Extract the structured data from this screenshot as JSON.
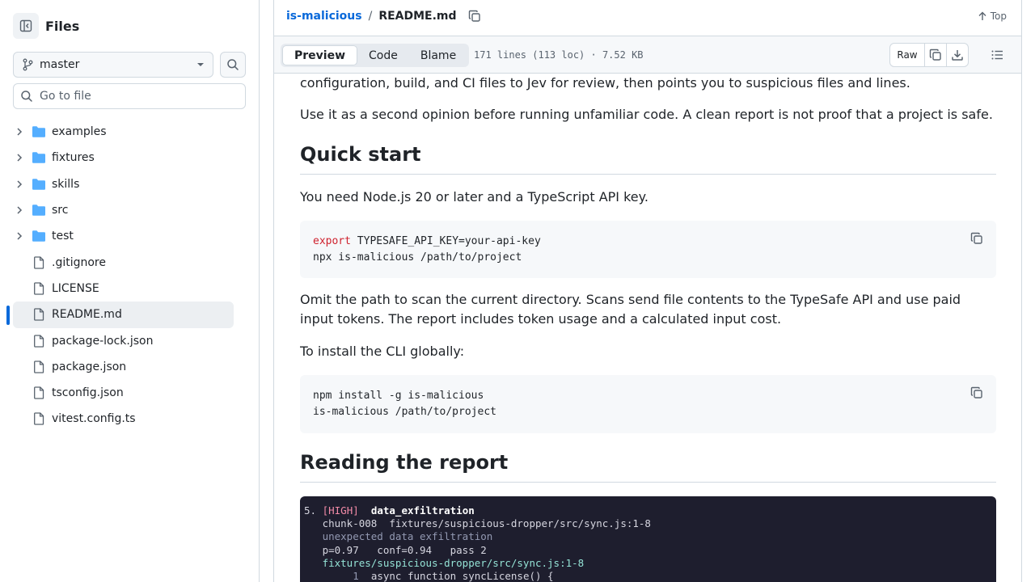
{
  "sidebar": {
    "title": "Files",
    "branch": "master",
    "goto_placeholder": "Go to file",
    "items": [
      {
        "name": "examples",
        "type": "folder"
      },
      {
        "name": "fixtures",
        "type": "folder"
      },
      {
        "name": "skills",
        "type": "folder"
      },
      {
        "name": "src",
        "type": "folder"
      },
      {
        "name": "test",
        "type": "folder"
      },
      {
        "name": ".gitignore",
        "type": "file"
      },
      {
        "name": "LICENSE",
        "type": "file"
      },
      {
        "name": "README.md",
        "type": "file",
        "selected": true
      },
      {
        "name": "package-lock.json",
        "type": "file"
      },
      {
        "name": "package.json",
        "type": "file"
      },
      {
        "name": "tsconfig.json",
        "type": "file"
      },
      {
        "name": "vitest.config.ts",
        "type": "file"
      }
    ]
  },
  "header": {
    "repo": "is-malicious",
    "separator": "/",
    "file": "README.md",
    "top_label": "Top"
  },
  "filebar": {
    "tabs": [
      "Preview",
      "Code",
      "Blame"
    ],
    "active_tab": "Preview",
    "info": "171 lines (113 loc) · 7.52 KB",
    "raw_label": "Raw"
  },
  "readme": {
    "intro_tail": "configuration, build, and CI files to Jev for review, then points you to suspicious files and lines.",
    "second_opinion": "Use it as a second opinion before running unfamiliar code. A clean report is not proof that a project is safe.",
    "quick_start_heading": "Quick start",
    "requirements": "You need Node.js 20 or later and a TypeScript API key.",
    "code1": {
      "line1_keyword": "export",
      "line1_rest": " TYPESAFE_API_KEY=your-api-key",
      "line2": "npx is-malicious /path/to/project"
    },
    "omit_path": "Omit the path to scan the current directory. Scans send file contents to the TypeSafe API and use paid input tokens. The report includes token usage and a calculated input cost.",
    "install_globally": "To install the CLI globally:",
    "code2": {
      "line1": "npm install -g is-malicious",
      "line2": "is-malicious /path/to/project"
    },
    "reading_heading": "Reading the report",
    "terminal": {
      "index": "5.",
      "severity": "[HIGH]",
      "category": "data_exfiltration",
      "chunk": "chunk-008  fixtures/suspicious-dropper/src/sync.js:1-8",
      "description": "unexpected data exfiltration",
      "stats": "p=0.97   conf=0.94   pass 2",
      "path": "fixtures/suspicious-dropper/src/sync.js:1-8",
      "code_line_no": "1",
      "code_line": "async function syncLicense() {"
    }
  },
  "colors": {
    "accent": "#0969da",
    "keyword": "#cf222e",
    "terminal_bg": "#1e1e2e",
    "terminal_severity": "#f38ba8",
    "terminal_path": "#94e2d5"
  }
}
